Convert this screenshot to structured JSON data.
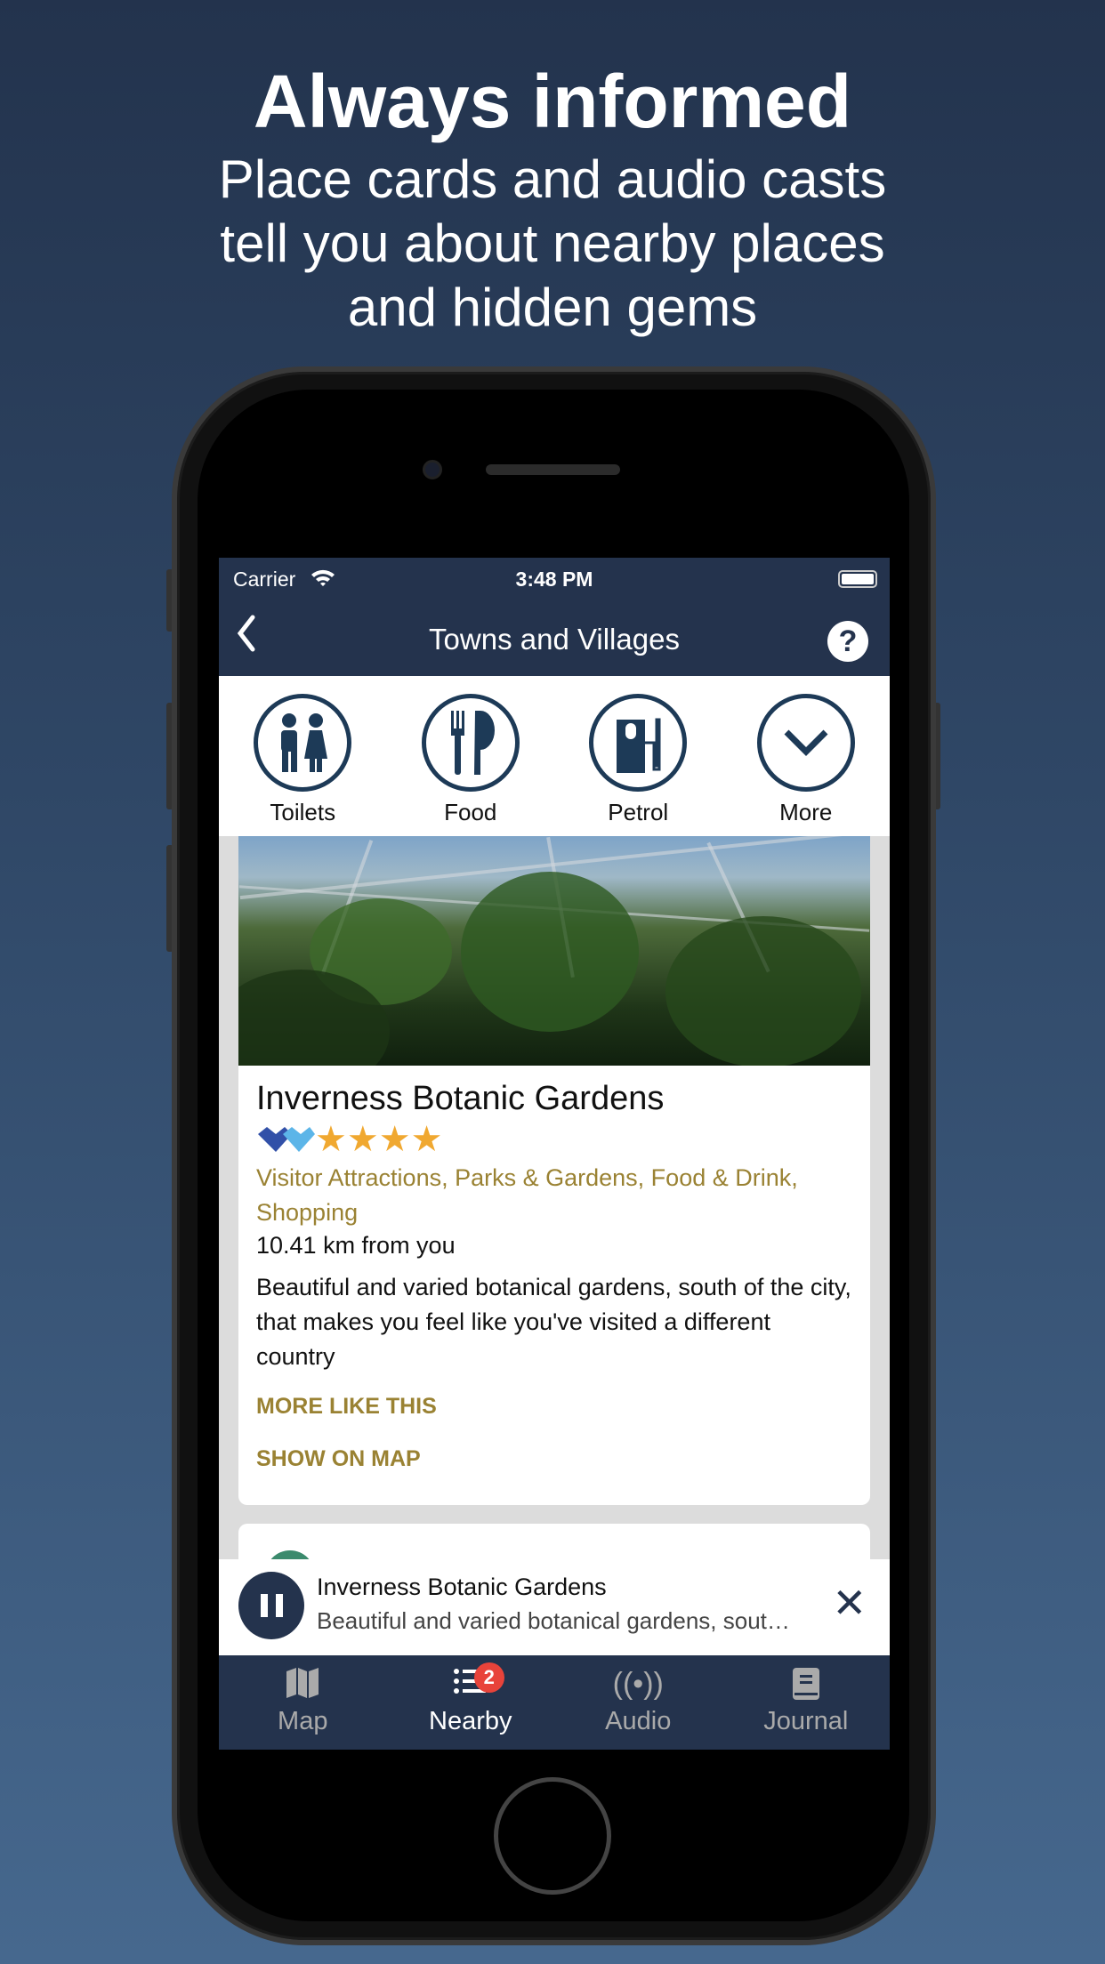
{
  "promo": {
    "headline": "Always informed",
    "subtitle_lines": [
      "Place cards and audio casts",
      "tell you about nearby places",
      "and hidden gems"
    ]
  },
  "status_bar": {
    "carrier": "Carrier",
    "time": "3:48 PM"
  },
  "nav": {
    "title": "Towns and Villages",
    "back_icon": "chevron-left-icon",
    "help_label": "?"
  },
  "categories": [
    {
      "label": "Toilets",
      "icon": "toilets-icon"
    },
    {
      "label": "Food",
      "icon": "food-icon"
    },
    {
      "label": "Petrol",
      "icon": "petrol-icon"
    },
    {
      "label": "More",
      "icon": "chevron-down-icon"
    }
  ],
  "place": {
    "name": "Inverness Botanic Gardens",
    "stars": 4,
    "categories": "Visitor Attractions, Parks & Gardens, Food & Drink, Shopping",
    "distance": "10.41 km from you",
    "description": "Beautiful and varied botanical gardens, south of the city, that makes you feel like you've visited a different country",
    "more_like_this": "MORE LIKE THIS",
    "show_on_map": "SHOW ON MAP"
  },
  "player": {
    "title": "Inverness Botanic Gardens",
    "subtitle": "Beautiful and varied botanical gardens, south of the city, that makes you feel like you've visited a different country",
    "close": "✕"
  },
  "tabs": [
    {
      "label": "Map"
    },
    {
      "label": "Nearby",
      "badge": "2",
      "active": true
    },
    {
      "label": "Audio"
    },
    {
      "label": "Journal"
    }
  ],
  "colors": {
    "navy": "#24334d",
    "gold": "#9a8233",
    "star": "#f0a830",
    "badge": "#e8433a"
  }
}
